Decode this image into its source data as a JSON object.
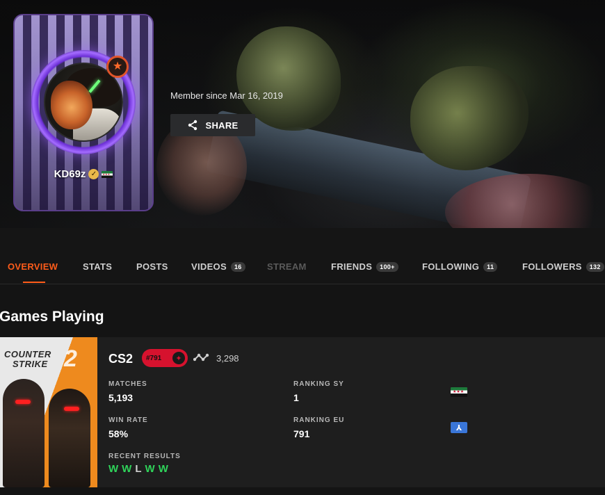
{
  "profile": {
    "username": "KD69z",
    "member_since": "Member since Mar 16, 2019",
    "share_label": "SHARE",
    "country_flag_icon": "flag-syria-icon",
    "verified_icon": "verified-badge-icon",
    "rank_badge_icon": "star-rank-icon"
  },
  "tabs": [
    {
      "label": "OVERVIEW",
      "count": "",
      "state": "active"
    },
    {
      "label": "STATS",
      "count": "",
      "state": "normal"
    },
    {
      "label": "POSTS",
      "count": "",
      "state": "normal"
    },
    {
      "label": "VIDEOS",
      "count": "16",
      "state": "normal"
    },
    {
      "label": "STREAM",
      "count": "",
      "state": "disabled"
    },
    {
      "label": "FRIENDS",
      "count": "100+",
      "state": "normal"
    },
    {
      "label": "FOLLOWING",
      "count": "11",
      "state": "normal"
    },
    {
      "label": "FOLLOWERS",
      "count": "132",
      "state": "normal"
    }
  ],
  "section_title": "Games Playing",
  "game": {
    "title": "CS2",
    "rank": "#791",
    "elo": "3,298",
    "cover_logo_line1": "COUNTER",
    "cover_logo_line2": "STRIKE",
    "cover_logo_number": "2",
    "stats": {
      "matches_label": "MATCHES",
      "matches": "5,193",
      "win_rate_label": "WIN RATE",
      "win_rate": "58%",
      "recent_results_label": "RECENT RESULTS",
      "recent_results": [
        "W",
        "W",
        "L",
        "W",
        "W"
      ],
      "ranking_sy_label": "RANKING SY",
      "ranking_sy": "1",
      "ranking_eu_label": "RANKING EU",
      "ranking_eu": "791"
    }
  },
  "colors": {
    "accent": "#ff5c1a",
    "win": "#2fd35a",
    "rank_pill": "#d6122e",
    "background": "#141414"
  }
}
